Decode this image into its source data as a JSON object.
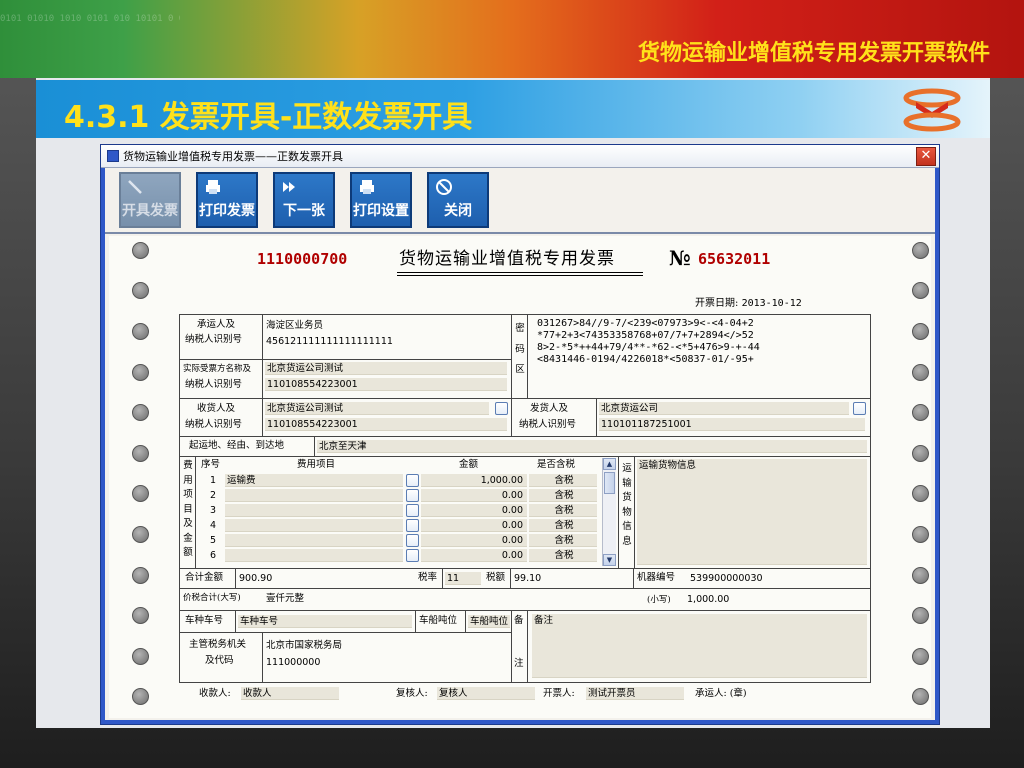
{
  "slide": {
    "app_title": "货物运输业增值税专用发票开票软件",
    "section_title": "4.3.1 发票开具-正数发票开具",
    "decor_digits": "0101 01010 1010 0101 010 10101 0 010 1 01010 1010 0101 010"
  },
  "window": {
    "title": "货物运输业增值税专用发票——正数发票开具",
    "close_label": "✕"
  },
  "toolbar": {
    "buttons": [
      {
        "label": "开具发票",
        "icon": "pen-icon",
        "enabled": false
      },
      {
        "label": "打印发票",
        "icon": "printer-icon",
        "enabled": true
      },
      {
        "label": "下一张",
        "icon": "fast-forward-icon",
        "enabled": true
      },
      {
        "label": "打印设置",
        "icon": "printer-icon",
        "enabled": true
      },
      {
        "label": "关闭",
        "icon": "cancel-icon",
        "enabled": true
      }
    ]
  },
  "invoice": {
    "code": "1110000700",
    "title": "货物运输业增值税专用发票",
    "no_mark": "№",
    "number": "65632011",
    "date_label": "开票日期:",
    "date_value": "2013-10-12",
    "carrier": {
      "label1": "承运人及",
      "label2": "纳税人识别号",
      "name": "海淀区业务员",
      "tax_id": "456121111111111111111"
    },
    "recipient": {
      "label1": "实际受票方名称及",
      "label2": "纳税人识别号",
      "name": "北京货运公司测试",
      "tax_id": "110108554223001"
    },
    "cipher_label": [
      "密",
      "码",
      "区"
    ],
    "cipher_lines": [
      "031267>84//9-7/<239<07973>9<-<4-04+2",
      "*77+2+3<74353358768+07/7+7+2894</>52",
      "8>2-*5*++44+79/4**-*62-<*5+476>9-+-44",
      "<8431446-0194/4226018*<50837-01/-95+"
    ],
    "consignee": {
      "label1": "收货人及",
      "label2": "纳税人识别号",
      "name": "北京货运公司测试",
      "tax_id": "110108554223001"
    },
    "consignor": {
      "label1": "发货人及",
      "label2": "纳税人识别号",
      "name": "北京货运公司",
      "tax_id": "110101187251001"
    },
    "route": {
      "label": "起运地、经由、到达地",
      "value": "北京至天津"
    },
    "fees": {
      "side_label": [
        "费",
        "用",
        "项",
        "目",
        "及",
        "金",
        "额"
      ],
      "headers": {
        "seq": "序号",
        "item": "费用项目",
        "amount": "金额",
        "tax_incl": "是否含税"
      },
      "rows": [
        {
          "seq": "1",
          "item": "运输费",
          "amount": "1,000.00",
          "tax_incl": "含税"
        },
        {
          "seq": "2",
          "item": "",
          "amount": "0.00",
          "tax_incl": "含税"
        },
        {
          "seq": "3",
          "item": "",
          "amount": "0.00",
          "tax_incl": "含税"
        },
        {
          "seq": "4",
          "item": "",
          "amount": "0.00",
          "tax_incl": "含税"
        },
        {
          "seq": "5",
          "item": "",
          "amount": "0.00",
          "tax_incl": "含税"
        },
        {
          "seq": "6",
          "item": "",
          "amount": "0.00",
          "tax_incl": "含税"
        }
      ]
    },
    "goods": {
      "side_label": [
        "运",
        "输",
        "货",
        "物",
        "信",
        "息"
      ],
      "value": "运输货物信息"
    },
    "totals": {
      "total_label": "合计金额",
      "total_value": "900.90",
      "rate_label": "税率",
      "rate_value": "11",
      "tax_label": "税额",
      "tax_value": "99.10",
      "machine_label": "机器编号",
      "machine_value": "539900000030"
    },
    "sum": {
      "label": "价税合计(大写)",
      "words": "壹仟元整",
      "small_label": "(小写)",
      "small_value": "1,000.00"
    },
    "vehicle": {
      "plate_label": "车种车号",
      "plate_value": "车种车号",
      "tonnage_label": "车船吨位",
      "tonnage_value": "车船吨位"
    },
    "authority": {
      "label1": "主管税务机关",
      "label2": "及代码",
      "name": "北京市国家税务局",
      "code": "111000000"
    },
    "remark": {
      "side_label": [
        "备",
        "注"
      ],
      "value": "备注"
    },
    "signatures": {
      "payee_label": "收款人:",
      "payee_value": "收款人",
      "reviewer_label": "复核人:",
      "reviewer_value": "复核人",
      "drawer_label": "开票人:",
      "drawer_value": "测试开票员",
      "carrier_label": "承运人: (章)"
    }
  }
}
